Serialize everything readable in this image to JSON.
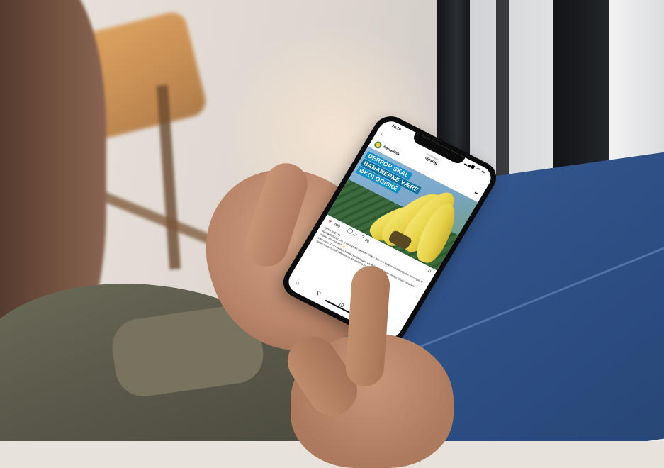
{
  "phone": {
    "status": {
      "time": "10.16",
      "icons": "▂▄▆ ◠ ▭"
    },
    "header": {
      "subtitle": "Kampagne",
      "title": "Opslag"
    },
    "post": {
      "author": "Rømødfisk",
      "headline": [
        "DERFOR SKAL",
        "BANANERNE VÆRE",
        "ØKOLOGISKE"
      ],
      "likes": "909",
      "comments": "17",
      "shares": "26",
      "caption": [
        "Synes godt om",
        "Rømødfisk Det ville vi økologiske bananer tilhøjer ikke kun kunder med pesticider, men også til miljøet omkring dem 🍌",
        "Læs mere: Den usynlige kunde her Økologisk Landsforening og de mange lokale initiativer henter brugere med løbende og de dyrker som ✔️"
      ]
    },
    "icons": {
      "back": "back-arrow-icon",
      "more": "more-dots-icon",
      "heart": "heart-icon",
      "comment": "comment-icon",
      "share": "share-icon",
      "bookmark": "bookmark-icon",
      "nav": [
        "home-icon",
        "search-icon",
        "reels-icon",
        "shop-icon"
      ]
    },
    "glyphs": {
      "back": "‹",
      "more": "•••",
      "heart": "♥",
      "comment": "◯",
      "share": "▽",
      "bookmark": "⌑",
      "home": "⌂",
      "search": "⚲",
      "reels": "⊡",
      "shop": "⊕"
    },
    "colors": {
      "headline_bg": "#0f8fc6",
      "heart": "#e33b3b",
      "bananas": "#f2e36a"
    }
  }
}
